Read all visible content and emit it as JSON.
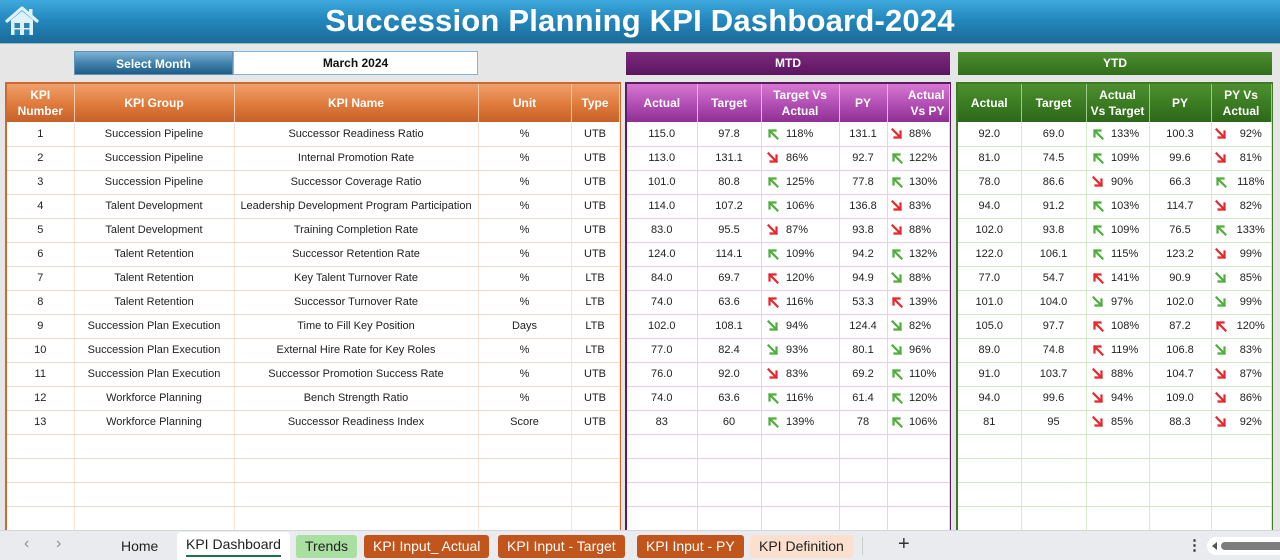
{
  "header": {
    "title": "Succession Planning KPI Dashboard-2024",
    "home_icon": "home-icon"
  },
  "month_selector": {
    "label": "Select Month",
    "value": "March 2024"
  },
  "sections": {
    "mtd_label": "MTD",
    "ytd_label": "YTD"
  },
  "colors": {
    "title_blue": "#2488bd",
    "kpi_orange": "#df7a3b",
    "mtd_purple": "#5b1660",
    "mtd_header": "#b04db3",
    "ytd_green": "#3a7b22",
    "up_green": "#4caf3a",
    "down_red": "#e8262a"
  },
  "kpi_table": {
    "columns": [
      "KPI Number",
      "KPI Group",
      "KPI Name",
      "Unit",
      "Type"
    ],
    "rows": [
      {
        "num": "1",
        "group": "Succession Pipeline",
        "name": "Successor Readiness Ratio",
        "unit": "%",
        "type": "UTB"
      },
      {
        "num": "2",
        "group": "Succession Pipeline",
        "name": "Internal Promotion Rate",
        "unit": "%",
        "type": "UTB"
      },
      {
        "num": "3",
        "group": "Succession Pipeline",
        "name": "Successor Coverage Ratio",
        "unit": "%",
        "type": "UTB"
      },
      {
        "num": "4",
        "group": "Talent Development",
        "name": "Leadership Development Program Participation",
        "unit": "%",
        "type": "UTB"
      },
      {
        "num": "5",
        "group": "Talent Development",
        "name": "Training Completion Rate",
        "unit": "%",
        "type": "UTB"
      },
      {
        "num": "6",
        "group": "Talent Retention",
        "name": "Successor Retention Rate",
        "unit": "%",
        "type": "UTB"
      },
      {
        "num": "7",
        "group": "Talent Retention",
        "name": "Key Talent Turnover Rate",
        "unit": "%",
        "type": "LTB"
      },
      {
        "num": "8",
        "group": "Talent Retention",
        "name": "Successor Turnover Rate",
        "unit": "%",
        "type": "LTB"
      },
      {
        "num": "9",
        "group": "Succession Plan Execution",
        "name": "Time to Fill Key Position",
        "unit": "Days",
        "type": "LTB"
      },
      {
        "num": "10",
        "group": "Succession Plan Execution",
        "name": "External Hire Rate for Key Roles",
        "unit": "%",
        "type": "LTB"
      },
      {
        "num": "11",
        "group": "Succession Plan Execution",
        "name": "Successor Promotion Success Rate",
        "unit": "%",
        "type": "UTB"
      },
      {
        "num": "12",
        "group": "Workforce Planning",
        "name": "Bench Strength Ratio",
        "unit": "%",
        "type": "UTB"
      },
      {
        "num": "13",
        "group": "Workforce Planning",
        "name": "Successor Readiness Index",
        "unit": "Score",
        "type": "UTB"
      }
    ]
  },
  "mtd_table": {
    "columns": [
      "Actual",
      "Target",
      "Target Vs Actual",
      "PY",
      "Actual Vs PY"
    ],
    "rows": [
      {
        "actual": "115.0",
        "target": "97.8",
        "tva_icon": "up-green",
        "tva": "118%",
        "py": "131.1",
        "avpy_icon": "down-red",
        "avpy": "88%"
      },
      {
        "actual": "113.0",
        "target": "131.1",
        "tva_icon": "down-red",
        "tva": "86%",
        "py": "92.7",
        "avpy_icon": "up-green",
        "avpy": "122%"
      },
      {
        "actual": "101.0",
        "target": "80.8",
        "tva_icon": "up-green",
        "tva": "125%",
        "py": "77.8",
        "avpy_icon": "up-green",
        "avpy": "130%"
      },
      {
        "actual": "114.0",
        "target": "107.2",
        "tva_icon": "up-green",
        "tva": "106%",
        "py": "136.8",
        "avpy_icon": "down-red",
        "avpy": "83%"
      },
      {
        "actual": "83.0",
        "target": "95.5",
        "tva_icon": "down-red",
        "tva": "87%",
        "py": "93.8",
        "avpy_icon": "down-red",
        "avpy": "88%"
      },
      {
        "actual": "124.0",
        "target": "114.1",
        "tva_icon": "up-green",
        "tva": "109%",
        "py": "94.2",
        "avpy_icon": "up-green",
        "avpy": "132%"
      },
      {
        "actual": "84.0",
        "target": "69.7",
        "tva_icon": "up-red",
        "tva": "120%",
        "py": "94.9",
        "avpy_icon": "down-green",
        "avpy": "88%"
      },
      {
        "actual": "74.0",
        "target": "63.6",
        "tva_icon": "up-red",
        "tva": "116%",
        "py": "53.3",
        "avpy_icon": "up-red",
        "avpy": "139%"
      },
      {
        "actual": "102.0",
        "target": "108.1",
        "tva_icon": "down-green",
        "tva": "94%",
        "py": "124.4",
        "avpy_icon": "down-green",
        "avpy": "82%"
      },
      {
        "actual": "77.0",
        "target": "82.4",
        "tva_icon": "down-green",
        "tva": "93%",
        "py": "80.1",
        "avpy_icon": "down-green",
        "avpy": "96%"
      },
      {
        "actual": "76.0",
        "target": "92.0",
        "tva_icon": "down-red",
        "tva": "83%",
        "py": "69.2",
        "avpy_icon": "up-green",
        "avpy": "110%"
      },
      {
        "actual": "74.0",
        "target": "63.6",
        "tva_icon": "up-green",
        "tva": "116%",
        "py": "61.4",
        "avpy_icon": "up-green",
        "avpy": "120%"
      },
      {
        "actual": "83",
        "target": "60",
        "tva_icon": "up-green",
        "tva": "139%",
        "py": "78",
        "avpy_icon": "up-green",
        "avpy": "106%"
      }
    ]
  },
  "ytd_table": {
    "columns": [
      "Actual",
      "Target",
      "Actual Vs Target",
      "PY",
      "PY Vs Actual"
    ],
    "rows": [
      {
        "actual": "92.0",
        "target": "69.0",
        "avt_icon": "up-green",
        "avt": "133%",
        "py": "100.3",
        "pyva_icon": "down-red",
        "pyva": "92%"
      },
      {
        "actual": "81.0",
        "target": "74.5",
        "avt_icon": "up-green",
        "avt": "109%",
        "py": "99.6",
        "pyva_icon": "down-red",
        "pyva": "81%"
      },
      {
        "actual": "78.0",
        "target": "86.6",
        "avt_icon": "down-red",
        "avt": "90%",
        "py": "66.3",
        "pyva_icon": "up-green",
        "pyva": "118%"
      },
      {
        "actual": "94.0",
        "target": "91.2",
        "avt_icon": "up-green",
        "avt": "103%",
        "py": "114.7",
        "pyva_icon": "down-red",
        "pyva": "82%"
      },
      {
        "actual": "102.0",
        "target": "93.8",
        "avt_icon": "up-green",
        "avt": "109%",
        "py": "76.5",
        "pyva_icon": "up-green",
        "pyva": "133%"
      },
      {
        "actual": "122.0",
        "target": "106.1",
        "avt_icon": "up-green",
        "avt": "115%",
        "py": "123.2",
        "pyva_icon": "down-red",
        "pyva": "99%"
      },
      {
        "actual": "77.0",
        "target": "54.7",
        "avt_icon": "up-red",
        "avt": "141%",
        "py": "90.9",
        "pyva_icon": "down-green",
        "pyva": "85%"
      },
      {
        "actual": "101.0",
        "target": "104.0",
        "avt_icon": "down-green",
        "avt": "97%",
        "py": "102.0",
        "pyva_icon": "down-green",
        "pyva": "99%"
      },
      {
        "actual": "105.0",
        "target": "97.7",
        "avt_icon": "up-red",
        "avt": "108%",
        "py": "87.2",
        "pyva_icon": "up-red",
        "pyva": "120%"
      },
      {
        "actual": "89.0",
        "target": "74.8",
        "avt_icon": "up-red",
        "avt": "119%",
        "py": "106.8",
        "pyva_icon": "down-green",
        "pyva": "83%"
      },
      {
        "actual": "91.0",
        "target": "103.7",
        "avt_icon": "down-red",
        "avt": "88%",
        "py": "104.7",
        "pyva_icon": "down-red",
        "pyva": "87%"
      },
      {
        "actual": "94.0",
        "target": "99.6",
        "avt_icon": "down-red",
        "avt": "94%",
        "py": "109.0",
        "pyva_icon": "down-red",
        "pyva": "86%"
      },
      {
        "actual": "81",
        "target": "95",
        "avt_icon": "down-red",
        "avt": "85%",
        "py": "88.3",
        "pyva_icon": "down-red",
        "pyva": "92%"
      }
    ]
  },
  "sheet_tabs": {
    "nav_prev": "‹",
    "nav_next": "›",
    "tabs": [
      {
        "label": "Home",
        "active": false
      },
      {
        "label": "KPI Dashboard",
        "active": true
      },
      {
        "label": "Trends",
        "active": false
      },
      {
        "label": "KPI Input_ Actual",
        "active": false
      },
      {
        "label": "KPI Input - Target",
        "active": false
      },
      {
        "label": "KPI Input - PY",
        "active": false
      },
      {
        "label": "KPI Definition",
        "active": false
      }
    ],
    "add_sheet": "+",
    "more": "⋮"
  }
}
